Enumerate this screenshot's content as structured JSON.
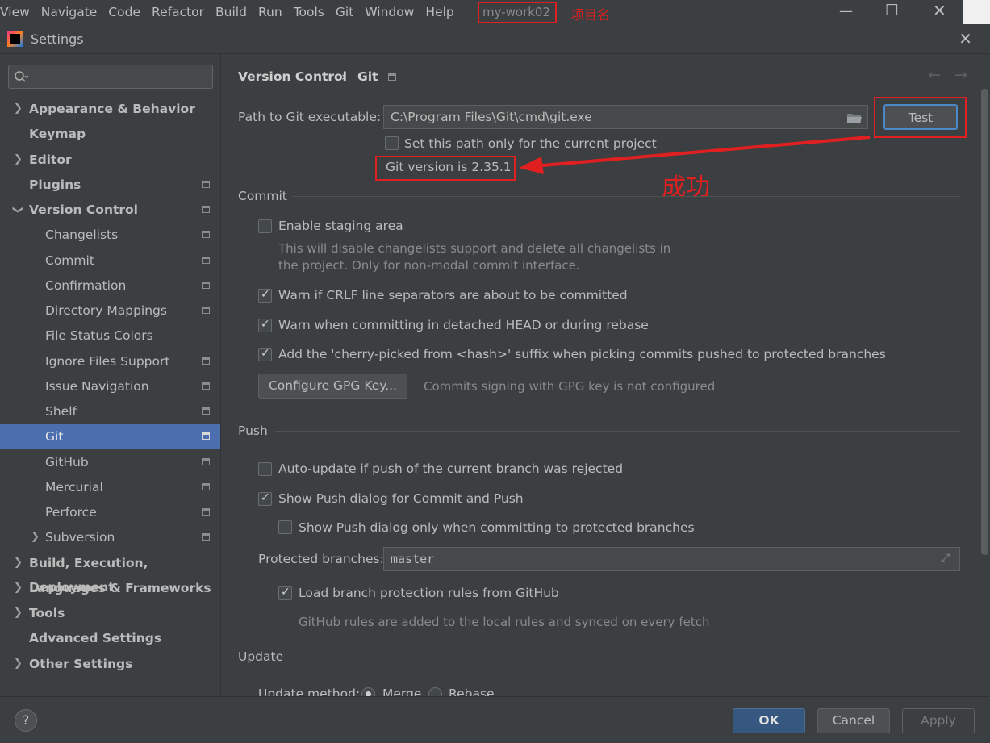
{
  "menubar": {
    "items": [
      "View",
      "Navigate",
      "Code",
      "Refactor",
      "Build",
      "Run",
      "Tools",
      "Git",
      "Window",
      "Help"
    ],
    "project_name": "my-work02",
    "project_note": "项目名"
  },
  "dialog": {
    "title": "Settings"
  },
  "sidebar": {
    "search_placeholder": "",
    "items": [
      {
        "label": "Appearance & Behavior"
      },
      {
        "label": "Keymap"
      },
      {
        "label": "Editor"
      },
      {
        "label": "Plugins"
      },
      {
        "label": "Version Control"
      },
      {
        "label": "Changelists"
      },
      {
        "label": "Commit"
      },
      {
        "label": "Confirmation"
      },
      {
        "label": "Directory Mappings"
      },
      {
        "label": "File Status Colors"
      },
      {
        "label": "Ignore Files Support"
      },
      {
        "label": "Issue Navigation"
      },
      {
        "label": "Shelf"
      },
      {
        "label": "Git"
      },
      {
        "label": "GitHub"
      },
      {
        "label": "Mercurial"
      },
      {
        "label": "Perforce"
      },
      {
        "label": "Subversion"
      },
      {
        "label": "Build, Execution, Deployment"
      },
      {
        "label": "Languages & Frameworks"
      },
      {
        "label": "Tools"
      },
      {
        "label": "Advanced Settings"
      },
      {
        "label": "Other Settings"
      }
    ]
  },
  "breadcrumb": {
    "parent": "Version Control",
    "separator": "›",
    "current": "Git"
  },
  "git_path": {
    "label": "Path to Git executable:",
    "value": "C:\\Program Files\\Git\\cmd\\git.exe",
    "test_label": "Test",
    "current_project_only": "Set this path only for the current project",
    "version_result": "Git version is 2.35.1",
    "success_note": "成功"
  },
  "commit": {
    "title": "Commit",
    "staging_label": "Enable staging area",
    "staging_desc_1": "This will disable changelists support and delete all changelists in",
    "staging_desc_2": "the project. Only for non-modal commit interface.",
    "crlf_label": "Warn if CRLF line separators are about to be committed",
    "detached_label": "Warn when committing in detached HEAD or during rebase",
    "cherry_label": "Add the 'cherry-picked from <hash>' suffix when picking commits pushed to protected branches",
    "gpg_button": "Configure GPG Key...",
    "gpg_status": "Commits signing with GPG key is not configured"
  },
  "push": {
    "title": "Push",
    "auto_update_label": "Auto-update if push of the current branch was rejected",
    "show_dialog_label": "Show Push dialog for Commit and Push",
    "show_dialog_protected_label": "Show Push dialog only when committing to protected branches",
    "protected_label": "Protected branches:",
    "protected_value": "master",
    "load_rules_label": "Load branch protection rules from GitHub",
    "load_rules_desc": "GitHub rules are added to the local rules and synced on every fetch"
  },
  "update": {
    "title": "Update",
    "method_label": "Update method:",
    "merge_label": "Merge",
    "rebase_label": "Rebase"
  },
  "footer": {
    "help": "?",
    "ok": "OK",
    "cancel": "Cancel",
    "apply": "Apply"
  }
}
